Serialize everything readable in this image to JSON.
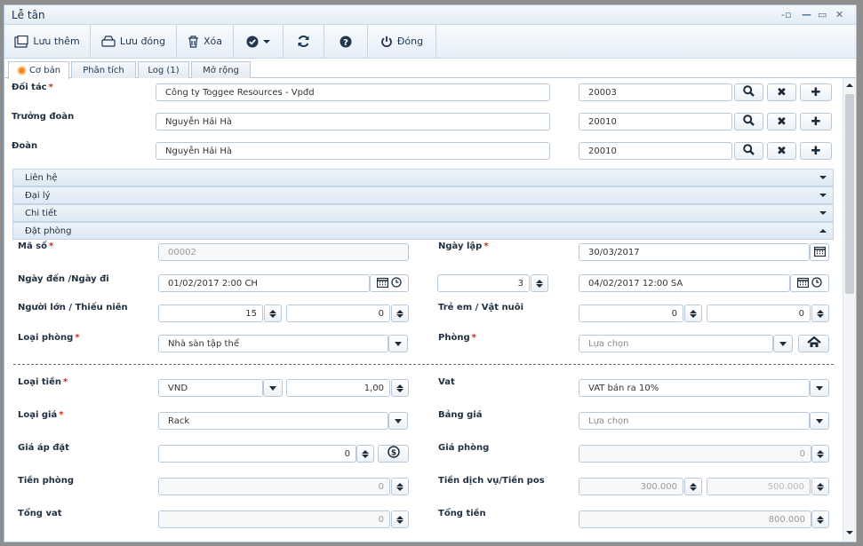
{
  "window": {
    "title": "Lễ tân"
  },
  "toolbar": {
    "save_new": "Lưu thêm",
    "save_close": "Lưu đóng",
    "delete": "Xóa",
    "close": "Đóng"
  },
  "tabs": [
    {
      "label": "Cơ bản"
    },
    {
      "label": "Phân tích"
    },
    {
      "label": "Log (1)"
    },
    {
      "label": "Mở rộng"
    }
  ],
  "partner": {
    "label": "Đối tác",
    "required_mark": "*",
    "value": "Công ty Toggee Resources - Vpđd",
    "code": "20003"
  },
  "leader": {
    "label": "Trưởng đoàn",
    "value": "Nguyễn Hải Hà",
    "code": "20010"
  },
  "group": {
    "label": "Đoàn",
    "value": "Nguyễn Hải Hà",
    "code": "20010"
  },
  "sections": [
    {
      "label": "Liên hệ",
      "state": "collapsed"
    },
    {
      "label": "Đại lý",
      "state": "collapsed"
    },
    {
      "label": "Chi tiết",
      "state": "collapsed"
    },
    {
      "label": "Đặt phòng",
      "state": "expanded"
    }
  ],
  "booking": {
    "code": {
      "label": "Mã số",
      "required_mark": "*",
      "value": "00002"
    },
    "created_date": {
      "label": "Ngày lập",
      "required_mark": "*",
      "value": "30/03/2017"
    },
    "arrive_depart": {
      "label": "Ngày đến /Ngày đi",
      "arrival": "01/02/2017 2:00 CH",
      "nights": "3",
      "departure": "04/02/2017 12:00 SA"
    },
    "adults_teens": {
      "label": "Người lớn / Thiếu niên",
      "adults": "15",
      "teens": "0"
    },
    "children_pets": {
      "label": "Trẻ em / Vật nuôi",
      "children": "0",
      "pets": "0"
    },
    "room_type": {
      "label": "Loại phòng",
      "required_mark": "*",
      "value": "Nhà sàn tập thể"
    },
    "room": {
      "label": "Phòng",
      "required_mark": "*",
      "placeholder": "Lựa chọn"
    },
    "currency": {
      "label": "Loại tiền",
      "required_mark": "*",
      "value": "VND",
      "rate": "1,00"
    },
    "vat": {
      "label": "Vat",
      "value": "VAT bán ra 10%"
    },
    "price_type": {
      "label": "Loại giá",
      "required_mark": "*",
      "value": "Rack"
    },
    "price_list": {
      "label": "Bảng giá",
      "placeholder": "Lựa chọn"
    },
    "applied_price": {
      "label": "Giá áp đặt",
      "value": "0"
    },
    "room_price": {
      "label": "Giá phòng",
      "value": "0"
    },
    "room_charge": {
      "label": "Tiền phòng",
      "value": "0"
    },
    "service_pos": {
      "label": "Tiền dịch vụ/Tiền pos",
      "service": "300.000",
      "pos": "500.000"
    },
    "total_vat": {
      "label": "Tổng vat",
      "value": "0"
    },
    "total": {
      "label": "Tổng tiền",
      "value": "800.000"
    }
  },
  "colors": {
    "accent": "#1f3550",
    "required": "#d9230f",
    "section_bg": "#e3ecf5",
    "tab_icon": "#f08c1a"
  }
}
